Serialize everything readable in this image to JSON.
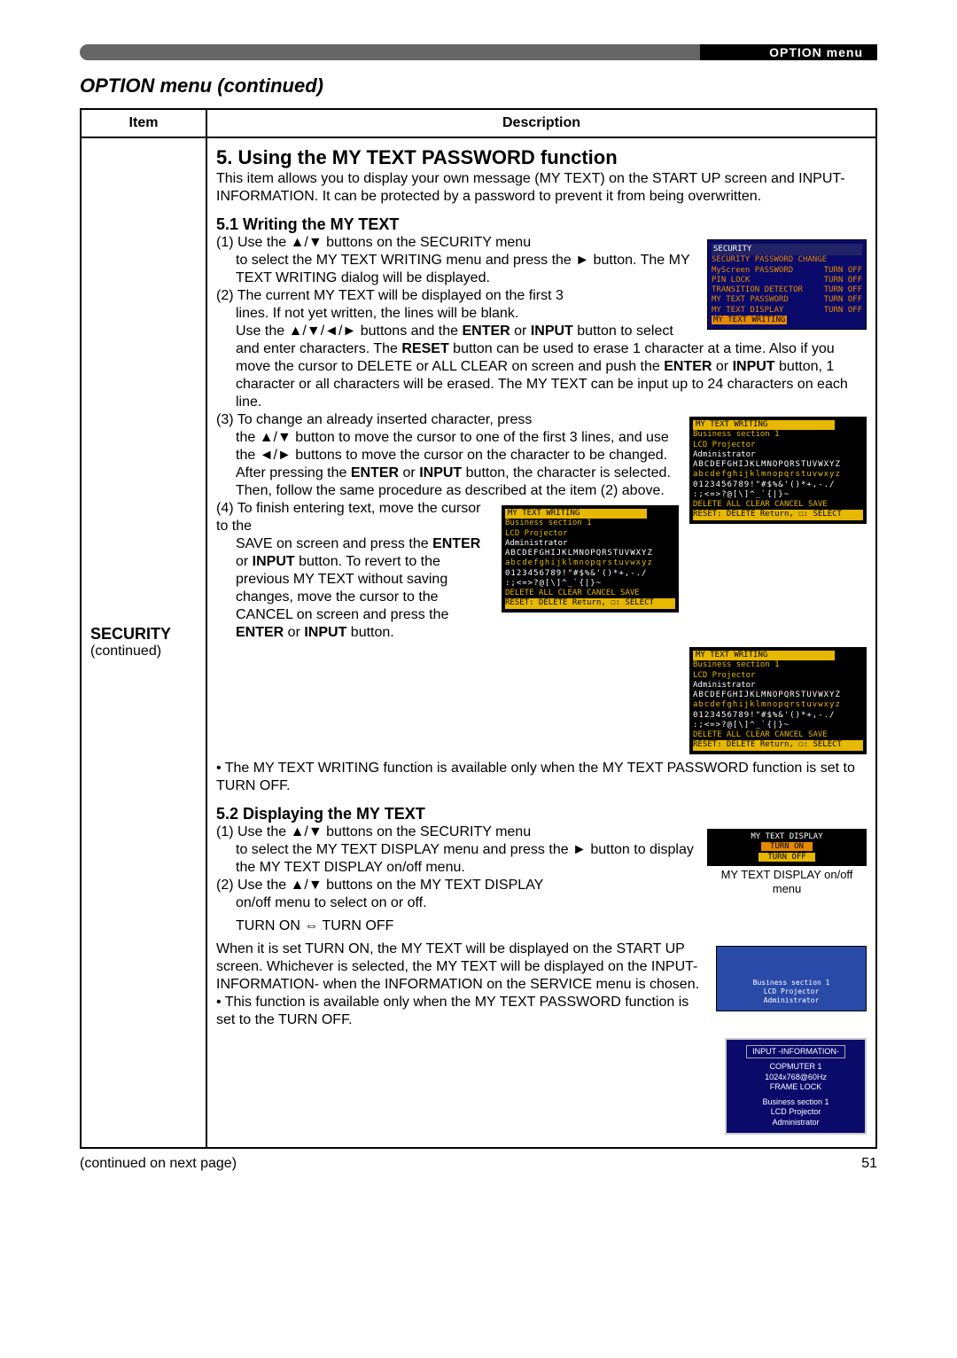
{
  "header": {
    "menu_tab": "OPTION menu"
  },
  "title": "OPTION menu (continued)",
  "table": {
    "head_item": "Item",
    "head_desc": "Description",
    "item_name": "SECURITY",
    "item_sub": "(continued)"
  },
  "heading5": "5. Using the MY TEXT PASSWORD function",
  "intro": "This item allows you to display your own message (MY TEXT) on the START UP screen and INPUT-INFORMATION. It can be protected by a password to prevent it from being overwritten.",
  "sub1": "5.1 Writing the MY TEXT",
  "p1a": "(1) Use the ▲/▼ buttons on the SECURITY menu",
  "p1b": "to select the MY TEXT WRITING menu and press the ► button. The MY TEXT WRITING dialog will be displayed.",
  "p2a": "(2) The current MY TEXT will be displayed on the first 3",
  "p2b": "lines. If not yet written, the lines will be blank.",
  "p2c_pre": "Use the ▲/▼/◄/► buttons and the ",
  "p2c_b1": "ENTER",
  "p2c_mid1": " or ",
  "p2c_b2": "INPUT",
  "p2c_mid2": " button to select and enter characters. The ",
  "p2c_b3": "RESET",
  "p2c_mid3": " button can be used to erase 1 character at a time. Also if you move the cursor to DELETE or ALL CLEAR on screen and push the ",
  "p2c_b4": "ENTER",
  "p2c_mid4": " or ",
  "p2c_b5": "INPUT",
  "p2c_end": " button, 1 character or all characters will be erased. The MY TEXT can be input up to 24 characters on each line.",
  "p3a": "(3) To change an already inserted character, press",
  "p3b_pre": "the ▲/▼ button to move the cursor to one of the first 3 lines, and use the ◄/► buttons to move the cursor on the character to be changed. After pressing the ",
  "p3b_b1": "ENTER",
  "p3b_mid1": " or ",
  "p3b_b2": "INPUT",
  "p3b_end": " button, the character is selected. Then, follow the same procedure as described at the item (2) above.",
  "p4a": "(4) To finish entering text, move the cursor to the",
  "p4b_pre": "SAVE on screen and press the ",
  "p4b_b1": "ENTER",
  "p4b_mid1": " or ",
  "p4b_b2": "INPUT",
  "p4b_mid2": " button. To revert to the previous MY TEXT without saving changes, move the cursor to the CANCEL on screen and press the ",
  "p4b_b3": "ENTER",
  "p4b_mid3": " or ",
  "p4b_b4": "INPUT",
  "p4b_end": " button.",
  "bullet1": "• The MY TEXT WRITING function is available only when the MY TEXT PASSWORD function is set to TURN OFF.",
  "sub2": "5.2 Displaying the MY TEXT",
  "d1a": "(1) Use the ▲/▼ buttons on the SECURITY menu",
  "d1b": "to select the MY TEXT DISPLAY menu and press the ► button to display the MY TEXT DISPLAY on/off menu.",
  "d2a": "(2) Use the ▲/▼ buttons on the MY TEXT DISPLAY",
  "d2b": "on/off menu to select on or off.",
  "toggle": "TURN ON ⇔ TURN OFF",
  "d3": "When it is set TURN ON, the MY TEXT will be displayed on the START UP screen. Whichever is selected, the MY TEXT will be displayed on the INPUT-INFORMATION- when the INFORMATION on the SERVICE menu is chosen.",
  "bullet2": "• This function is available only when the MY TEXT PASSWORD function is set to the TURN OFF.",
  "footer_cont": "(continued on next page)",
  "page_no": "51",
  "osd1": {
    "title": "SECURITY",
    "rows": [
      [
        "SECURITY PASSWORD CHANGE",
        ""
      ],
      [
        "MyScreen PASSWORD",
        "TURN OFF"
      ],
      [
        "PIN LOCK",
        "TURN OFF"
      ],
      [
        "TRANSITION DETECTOR",
        "TURN OFF"
      ],
      [
        "MY TEXT PASSWORD",
        "TURN OFF"
      ],
      [
        "MY TEXT DISPLAY",
        "TURN OFF"
      ]
    ],
    "hl": "MY TEXT WRITING"
  },
  "osd_keypad": {
    "title": "MY TEXT WRITING",
    "line1": "Business section 1",
    "line2": "LCD Projector",
    "line3": "Administrator",
    "rowA": "ABCDEFGHIJKLMNOPQRSTUVWXYZ",
    "rowB": "abcdefghijklmnopqrstuvwxyz",
    "rowC": "0123456789!\"#$%&'()*+,-./",
    "rowD": ":;<=>?@[\\]^_`{|}~                  ",
    "btns": "DELETE   ALL CLEAR        CANCEL   SAVE",
    "hint": "RESET: DELETE            Return, ☐: SELECT"
  },
  "osd_disp": {
    "title": "MY TEXT DISPLAY",
    "on": "TURN ON",
    "off": "TURN OFF",
    "caption": "MY TEXT DISPLAY on/off menu"
  },
  "startup": {
    "l1": "Business section 1",
    "l2": "LCD Projector",
    "l3": "Administrator"
  },
  "info": {
    "hdr": "INPUT -INFORMATION-",
    "l1": "COPMUTER 1",
    "l2": "1024x768@60Hz",
    "l3": "FRAME LOCK",
    "l4": "Business section 1",
    "l5": "LCD Projector",
    "l6": "Administrator"
  }
}
